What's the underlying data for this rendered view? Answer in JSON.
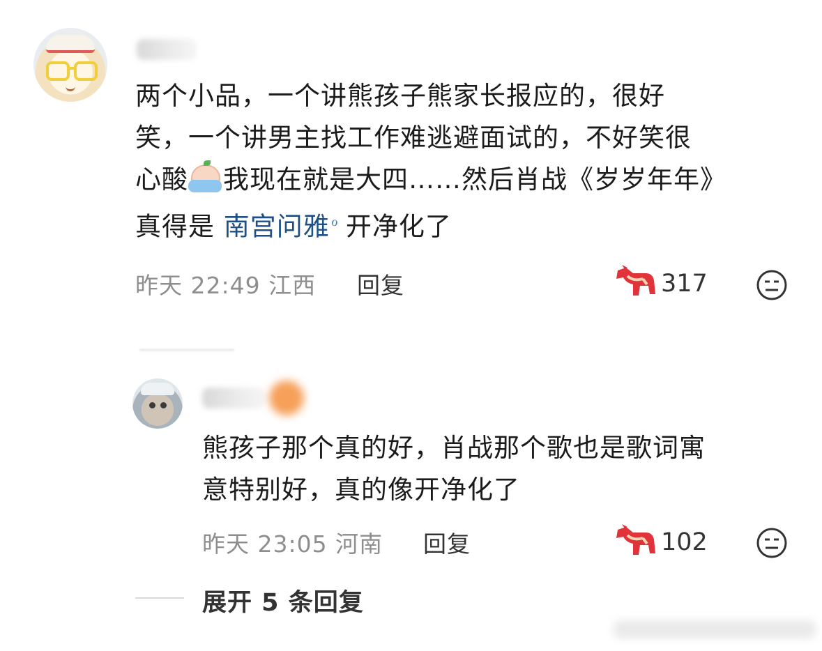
{
  "main_comment": {
    "text_before_mention": "两个小品，一个讲熊孩子熊家长报应的，很好\n笑，一个讲男主找工作难逃避面试的，不好笑很\n心酸",
    "text_after_emoji": "我现在就是大四……然后肖战《岁岁年年》\n真得是 ",
    "mention": "南宫问雅",
    "search_mark": "ℴ",
    "text_after_mention": "开净化了",
    "emoji_icon": "crying-face-emoji",
    "time": "昨天 22:49",
    "location": "江西",
    "reply_label": "回复",
    "like_count": "317"
  },
  "reply_comment": {
    "text": "熊孩子那个真的好，肖战那个歌也是歌词寓\n意特别好，真的像开净化了",
    "time": "昨天 23:05",
    "location": "河南",
    "reply_label": "回复",
    "like_count": "102"
  },
  "expand": {
    "label": "展开 5 条回复"
  },
  "icons": {
    "like": "red-horse-like-icon",
    "dislike": "meh-face-icon"
  },
  "colors": {
    "mention": "#1e4f86",
    "like_icon": "#e0343a",
    "meta": "#8e8e8e"
  }
}
